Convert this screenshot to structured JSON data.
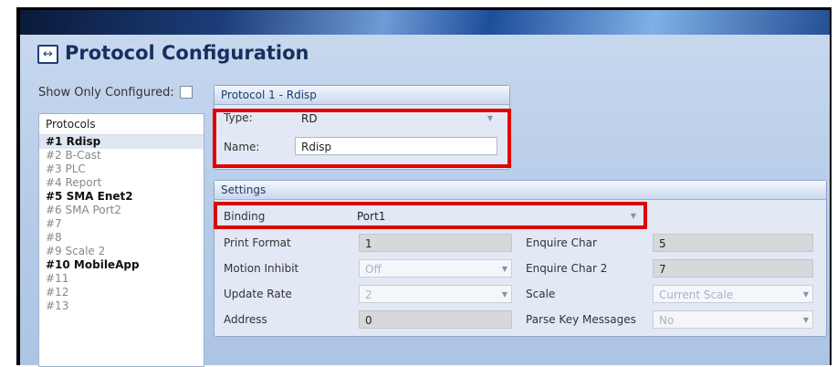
{
  "page": {
    "title": "Protocol Configuration",
    "title_icon": "swap-arrows-icon"
  },
  "filter": {
    "label": "Show Only Configured:",
    "checked": false
  },
  "protocols": {
    "header": "Protocols",
    "items": [
      {
        "label": "#1 Rdisp",
        "configured": true,
        "selected": true
      },
      {
        "label": "#2 B-Cast",
        "configured": false
      },
      {
        "label": "#3 PLC",
        "configured": false
      },
      {
        "label": "#4 Report",
        "configured": false
      },
      {
        "label": "#5 SMA Enet2",
        "configured": true
      },
      {
        "label": "#6 SMA Port2",
        "configured": false
      },
      {
        "label": "#7",
        "configured": false
      },
      {
        "label": "#8",
        "configured": false
      },
      {
        "label": "#9 Scale 2",
        "configured": false
      },
      {
        "label": "#10 MobileApp",
        "configured": true
      },
      {
        "label": "#11",
        "configured": false
      },
      {
        "label": "#12",
        "configured": false
      },
      {
        "label": "#13",
        "configured": false
      }
    ]
  },
  "protocol_panel": {
    "header": "Protocol 1 - Rdisp",
    "type_label": "Type:",
    "type_value": "RD",
    "name_label": "Name:",
    "name_value": "Rdisp"
  },
  "settings": {
    "header": "Settings",
    "binding_label": "Binding",
    "binding_value": "Port1",
    "print_format_label": "Print Format",
    "print_format_value": "1",
    "motion_inhibit_label": "Motion Inhibit",
    "motion_inhibit_value": "Off",
    "update_rate_label": "Update Rate",
    "update_rate_value": "2",
    "address_label": "Address",
    "address_value": "0",
    "enquire_char_label": "Enquire Char",
    "enquire_char_value": "5",
    "enquire_char2_label": "Enquire Char 2",
    "enquire_char2_value": "7",
    "scale_label": "Scale",
    "scale_value": "Current Scale",
    "parse_key_label": "Parse Key Messages",
    "parse_key_value": "No"
  },
  "colors": {
    "highlight": "#e00000",
    "title": "#15305e",
    "panel_bg": "#b5cbe8"
  }
}
